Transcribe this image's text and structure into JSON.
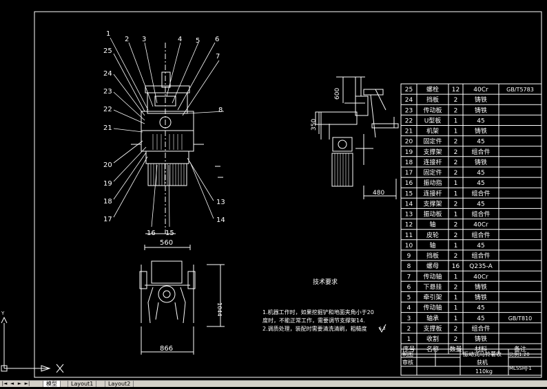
{
  "colors": {
    "background": "#000000",
    "lines": "#ffffff",
    "frame": "#ffffff"
  },
  "callouts": [
    "1",
    "2",
    "3",
    "4",
    "5",
    "6",
    "7",
    "8",
    "13",
    "14",
    "15",
    "16",
    "17",
    "18",
    "19",
    "20",
    "21",
    "22",
    "23",
    "24",
    "25"
  ],
  "dimensions": {
    "top_width": "560",
    "base_width": "866",
    "height": "1044",
    "side_height": "600",
    "side_offset": "350",
    "side_width": "480"
  },
  "notes": {
    "title": "技术要求",
    "line1": "1.机器工作时，如果挖掘铲和地面夹角小于20",
    "line2": "度时，不能正常工作，需要调节支撑架14.",
    "line3": "2.调质处理，装配时需要清洗清刷，粗糙度",
    "symbol": "6.3"
  },
  "parts_table": {
    "rows": [
      {
        "no": "25",
        "name": "螺栓",
        "qty": "12",
        "material": "40Cr",
        "note": "GB/T5783"
      },
      {
        "no": "24",
        "name": "挡板",
        "qty": "2",
        "material": "铸铁",
        "note": ""
      },
      {
        "no": "23",
        "name": "传动板",
        "qty": "2",
        "material": "铸铁",
        "note": ""
      },
      {
        "no": "22",
        "name": "U型板",
        "qty": "1",
        "material": "45",
        "note": ""
      },
      {
        "no": "21",
        "name": "机架",
        "qty": "1",
        "material": "铸铁",
        "note": ""
      },
      {
        "no": "20",
        "name": "固定件",
        "qty": "2",
        "material": "45",
        "note": ""
      },
      {
        "no": "19",
        "name": "支撑架",
        "qty": "2",
        "material": "组合件",
        "note": ""
      },
      {
        "no": "18",
        "name": "连接杆",
        "qty": "2",
        "material": "铸铁",
        "note": ""
      },
      {
        "no": "17",
        "name": "固定件",
        "qty": "2",
        "material": "45",
        "note": ""
      },
      {
        "no": "16",
        "name": "振动指",
        "qty": "1",
        "material": "45",
        "note": ""
      },
      {
        "no": "15",
        "name": "连接杆",
        "qty": "1",
        "material": "组合件",
        "note": ""
      },
      {
        "no": "14",
        "name": "支撑架",
        "qty": "2",
        "material": "45",
        "note": ""
      },
      {
        "no": "13",
        "name": "振动板",
        "qty": "1",
        "material": "组合件",
        "note": ""
      },
      {
        "no": "12",
        "name": "轴",
        "qty": "2",
        "material": "40Cr",
        "note": ""
      },
      {
        "no": "11",
        "name": "皮轮",
        "qty": "2",
        "material": "组合件",
        "note": ""
      },
      {
        "no": "10",
        "name": "轴",
        "qty": "1",
        "material": "45",
        "note": ""
      },
      {
        "no": "9",
        "name": "挡板",
        "qty": "2",
        "material": "组合件",
        "note": ""
      },
      {
        "no": "8",
        "name": "螺母",
        "qty": "16",
        "material": "Q235-A",
        "note": ""
      },
      {
        "no": "7",
        "name": "传动轴",
        "qty": "1",
        "material": "40Cr",
        "note": ""
      },
      {
        "no": "6",
        "name": "下悬挂",
        "qty": "2",
        "material": "铸铁",
        "note": ""
      },
      {
        "no": "5",
        "name": "牵引架",
        "qty": "1",
        "material": "铸铁",
        "note": ""
      },
      {
        "no": "4",
        "name": "传动轴",
        "qty": "1",
        "material": "45",
        "note": ""
      },
      {
        "no": "3",
        "name": "轴承",
        "qty": "1",
        "material": "45",
        "note": "GB/T810"
      },
      {
        "no": "2",
        "name": "支撑板",
        "qty": "2",
        "material": "组合件",
        "note": ""
      },
      {
        "no": "1",
        "name": "收割",
        "qty": "2",
        "material": "铸铁",
        "note": ""
      }
    ],
    "header": {
      "no": "序号",
      "name": "名称",
      "qty": "数量",
      "material": "材料",
      "note": "备注"
    }
  },
  "title_block": {
    "draw_label": "制图",
    "review_label": "审核",
    "title_line1": "振动式马铃薯收",
    "title_line2": "获机",
    "scale": "比例1:20",
    "weight": "110kg",
    "code": "MLSSHJ-1"
  },
  "layout_tabs": [
    {
      "label": "模型",
      "active": true
    },
    {
      "label": "Layout1",
      "active": false
    },
    {
      "label": "Layout2",
      "active": false
    }
  ]
}
